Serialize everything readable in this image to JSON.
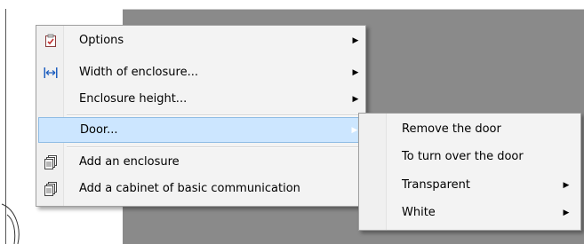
{
  "main_menu": {
    "items": [
      {
        "label": "Options",
        "icon": "checklist-icon",
        "has_submenu": true
      },
      {
        "label": "Width of enclosure...",
        "icon": "width-arrows-icon",
        "has_submenu": true
      },
      {
        "label": "Enclosure height...",
        "icon": "",
        "has_submenu": true
      },
      {
        "label": "Door...",
        "icon": "",
        "has_submenu": true,
        "highlighted": true
      },
      {
        "label": "Add an enclosure",
        "icon": "stacked-pages-icon",
        "has_submenu": false
      },
      {
        "label": "Add a cabinet of basic communication",
        "icon": "stacked-pages-icon",
        "has_submenu": false
      }
    ]
  },
  "submenu": {
    "items": [
      {
        "label": "Remove the door",
        "has_submenu": false
      },
      {
        "label": "To turn over the door",
        "has_submenu": false
      },
      {
        "label": "Transparent",
        "has_submenu": true
      },
      {
        "label": "White",
        "has_submenu": true
      }
    ]
  },
  "colors": {
    "highlight": "#cce6ff",
    "highlight_border": "#8fbce4",
    "menu_background": "#f3f3f3",
    "backdrop": "#8a8a8a"
  }
}
